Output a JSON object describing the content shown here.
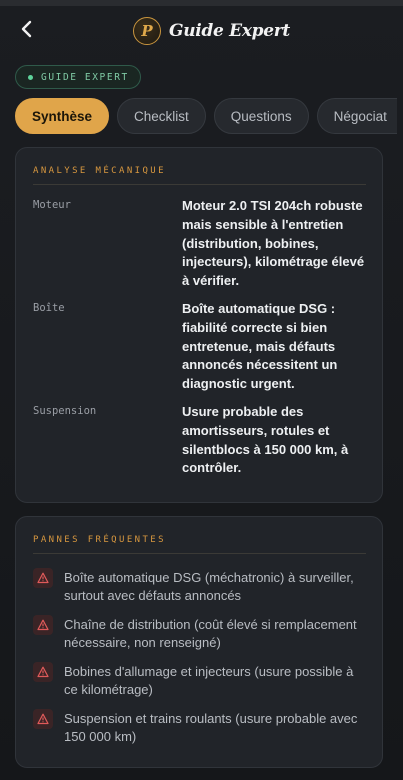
{
  "header": {
    "back_icon": "chevron-left-icon",
    "logo_letter": "P",
    "title": "Guide Expert"
  },
  "badge": {
    "label": "GUIDE EXPERT",
    "dot_color": "#5ed39b"
  },
  "tabs": [
    {
      "label": "Synthèse",
      "active": true
    },
    {
      "label": "Checklist",
      "active": false
    },
    {
      "label": "Questions",
      "active": false
    },
    {
      "label": "Négociat",
      "active": false
    }
  ],
  "analyse": {
    "section_title": "ANALYSE MÉCANIQUE",
    "rows": [
      {
        "key": "Moteur",
        "value": "Moteur 2.0 TSI 204ch robuste mais sensible à l'entretien (distribution, bobines, injecteurs), kilométrage élevé à vérifier."
      },
      {
        "key": "Boîte",
        "value": "Boîte automatique DSG : fiabilité correcte si bien entretenue, mais défauts annoncés nécessitent un diagnostic urgent."
      },
      {
        "key": "Suspension",
        "value": "Usure probable des amortisseurs, rotules et silentblocs à 150 000 km, à contrôler."
      }
    ]
  },
  "pannes": {
    "section_title": "PANNES FRÉQUENTES",
    "items": [
      {
        "icon": "warning-triangle-icon",
        "text": "Boîte automatique DSG (méchatronic) à surveiller, surtout avec défauts annoncés"
      },
      {
        "icon": "warning-triangle-icon",
        "text": "Chaîne de distribution (coût élevé si remplacement nécessaire, non renseigné)"
      },
      {
        "icon": "warning-triangle-icon",
        "text": "Bobines d'allumage et injecteurs (usure possible à ce kilométrage)"
      },
      {
        "icon": "warning-triangle-icon",
        "text": "Suspension et trains roulants (usure probable avec 150 000 km)"
      }
    ]
  },
  "colors": {
    "accent": "#e0a54a",
    "section_label": "#d7973f",
    "warning": "#e05a5a"
  }
}
